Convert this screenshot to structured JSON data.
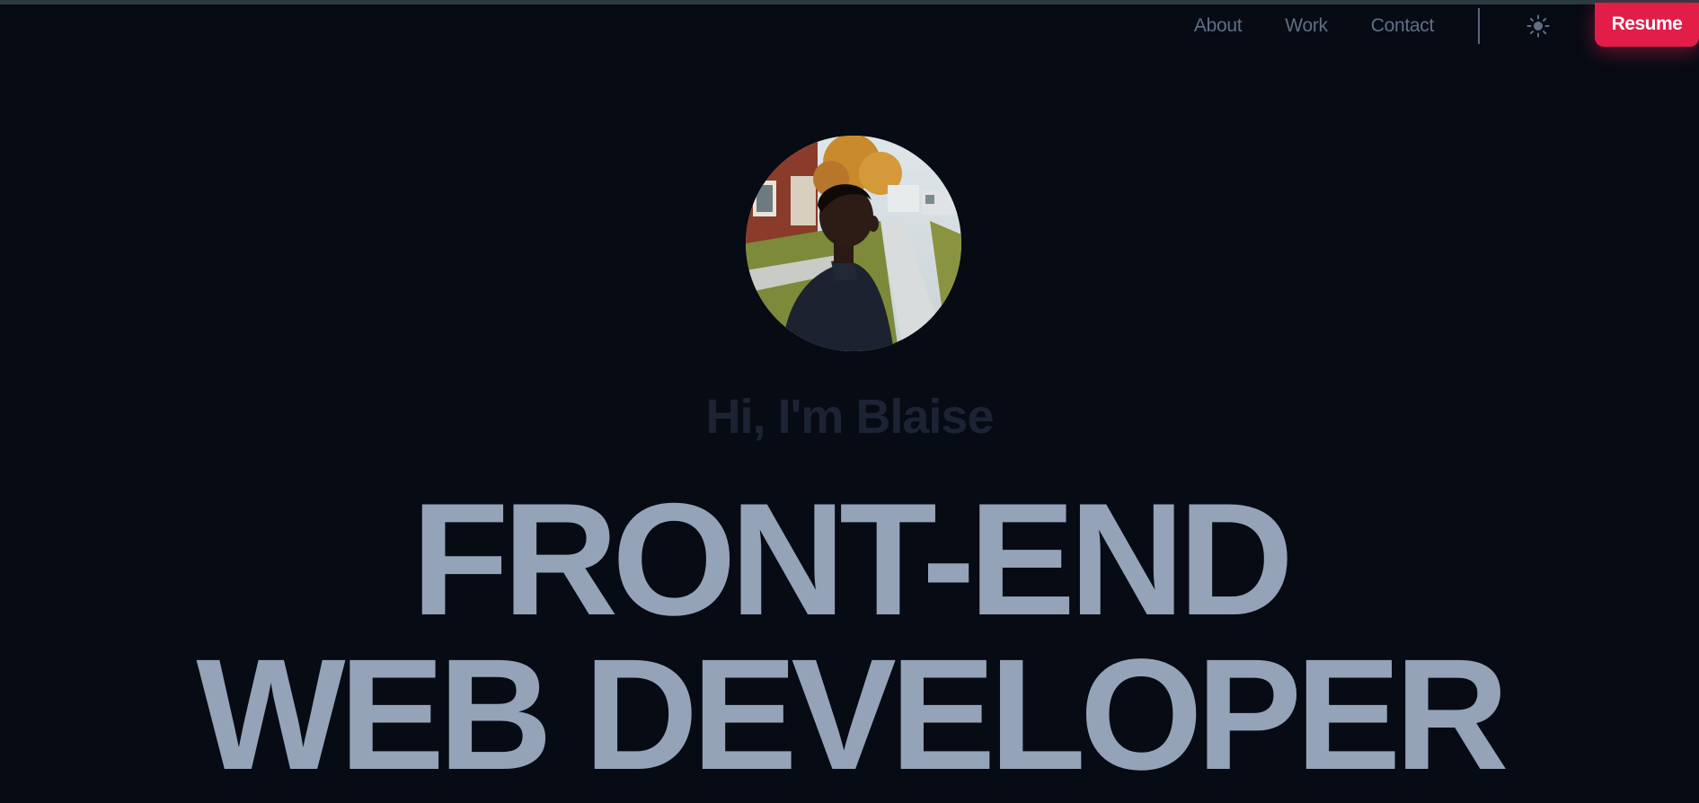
{
  "nav": {
    "links": [
      {
        "label": "About"
      },
      {
        "label": "Work"
      },
      {
        "label": "Contact"
      }
    ],
    "theme_toggle_icon": "sun-icon",
    "resume_label": "Resume"
  },
  "hero": {
    "greeting": "Hi, I'm Blaise",
    "headline_line1": "FRONT-END",
    "headline_line2": "WEB DEVELOPER"
  },
  "colors": {
    "background": "#070b14",
    "accent": "#e11d48",
    "headline": "#94a3b8",
    "nav_text": "#5f6f86",
    "greeting": "#1c2434"
  }
}
